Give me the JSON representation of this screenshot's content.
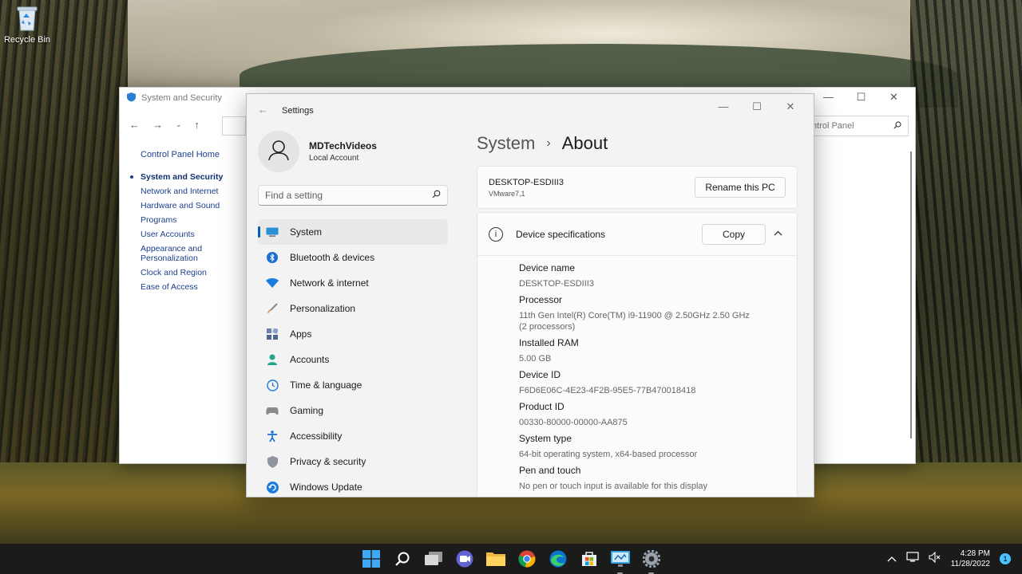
{
  "desktop": {
    "recycle_bin_label": "Recycle Bin"
  },
  "control_panel": {
    "title": "System and Security",
    "search_placeholder": "ntrol Panel",
    "home_link": "Control Panel Home",
    "sidebar_links": [
      {
        "label": "System and Security",
        "current": true
      },
      {
        "label": "Network and Internet"
      },
      {
        "label": "Hardware and Sound"
      },
      {
        "label": "Programs"
      },
      {
        "label": "User Accounts"
      },
      {
        "label": "Appearance and Personalization"
      },
      {
        "label": "Clock and Region"
      },
      {
        "label": "Ease of Access"
      }
    ]
  },
  "settings": {
    "app_title": "Settings",
    "user": {
      "name": "MDTechVideos",
      "account_type": "Local Account"
    },
    "search_placeholder": "Find a setting",
    "nav": [
      {
        "label": "System",
        "icon": "monitor-icon",
        "active": true
      },
      {
        "label": "Bluetooth & devices",
        "icon": "bluetooth-icon"
      },
      {
        "label": "Network & internet",
        "icon": "wifi-icon"
      },
      {
        "label": "Personalization",
        "icon": "brush-icon"
      },
      {
        "label": "Apps",
        "icon": "apps-icon"
      },
      {
        "label": "Accounts",
        "icon": "accounts-icon"
      },
      {
        "label": "Time & language",
        "icon": "globe-clock-icon"
      },
      {
        "label": "Gaming",
        "icon": "gamepad-icon"
      },
      {
        "label": "Accessibility",
        "icon": "accessibility-icon"
      },
      {
        "label": "Privacy & security",
        "icon": "shield-icon"
      },
      {
        "label": "Windows Update",
        "icon": "update-icon"
      }
    ],
    "breadcrumb": {
      "parent": "System",
      "separator": "›",
      "current": "About"
    },
    "pc": {
      "name": "DESKTOP-ESDIII3",
      "model": "VMware7,1",
      "rename_label": "Rename this PC"
    },
    "specs": {
      "title": "Device specifications",
      "copy_label": "Copy",
      "rows": [
        {
          "key": "Device name",
          "value": "DESKTOP-ESDIII3"
        },
        {
          "key": "Processor",
          "value": "11th Gen Intel(R) Core(TM) i9-11900 @ 2.50GHz   2.50 GHz  (2 processors)"
        },
        {
          "key": "Installed RAM",
          "value": "5.00 GB"
        },
        {
          "key": "Device ID",
          "value": "F6D6E06C-4E23-4F2B-95E5-77B470018418"
        },
        {
          "key": "Product ID",
          "value": "00330-80000-00000-AA875"
        },
        {
          "key": "System type",
          "value": "64-bit operating system, x64-based processor"
        },
        {
          "key": "Pen and touch",
          "value": "No pen or touch input is available for this display"
        }
      ]
    }
  },
  "taskbar": {
    "time": "4:28 PM",
    "date": "11/28/2022",
    "notification_count": "1",
    "accent_color": "#4cc2ff"
  }
}
